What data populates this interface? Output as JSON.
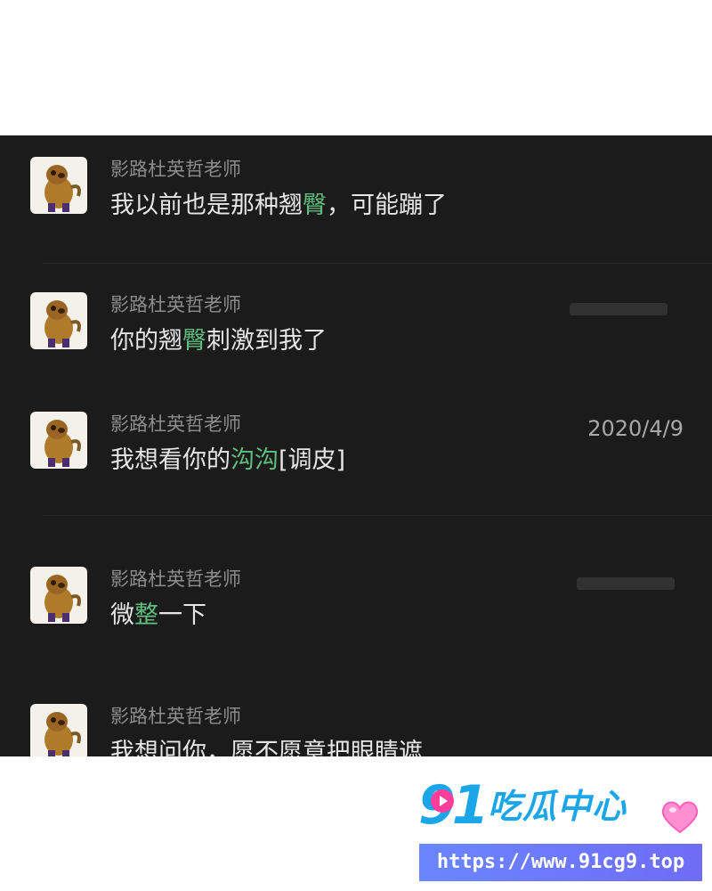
{
  "messages": [
    {
      "sender": "影路杜英哲老师",
      "timestamp": "",
      "text_parts": [
        {
          "text": "我以前也是那种翘",
          "hl": false
        },
        {
          "text": "臀",
          "hl": true
        },
        {
          "text": "，可能蹦了",
          "hl": false
        }
      ]
    },
    {
      "sender": "影路杜英哲老师",
      "timestamp": "",
      "text_parts": [
        {
          "text": "你的翘",
          "hl": false
        },
        {
          "text": "臀",
          "hl": true
        },
        {
          "text": "刺激到我了",
          "hl": false
        }
      ]
    },
    {
      "sender": "影路杜英哲老师",
      "timestamp": "2020/4/9",
      "text_parts": [
        {
          "text": "我想看你的",
          "hl": false
        },
        {
          "text": "沟沟",
          "hl": true
        },
        {
          "text": "[调皮]",
          "hl": false
        }
      ]
    },
    {
      "sender": "影路杜英哲老师",
      "timestamp": "",
      "text_parts": [
        {
          "text": "微",
          "hl": false
        },
        {
          "text": "整",
          "hl": true
        },
        {
          "text": "一下",
          "hl": false
        }
      ]
    },
    {
      "sender": "影路杜英哲老师",
      "timestamp": "",
      "text_parts": [
        {
          "text": "我想问你，愿不愿意把眼睛遮",
          "hl": false
        }
      ]
    }
  ],
  "watermark": {
    "number": "91",
    "name": "吃瓜中心",
    "url": "https://www.91cg9.top"
  },
  "colors": {
    "chat_background": "#1b1b1c",
    "message_text": "#e6e6e6",
    "sender_text": "#8d8d8d",
    "keyword_highlight": "#5fbf7c",
    "brand_blue": "#1aa6e8",
    "url_bar": "#6a86ff"
  },
  "icons": {
    "avatar": "cartoon-dog-avatar-icon",
    "brand_play": "play-icon",
    "brand_heart": "heart-icon"
  }
}
